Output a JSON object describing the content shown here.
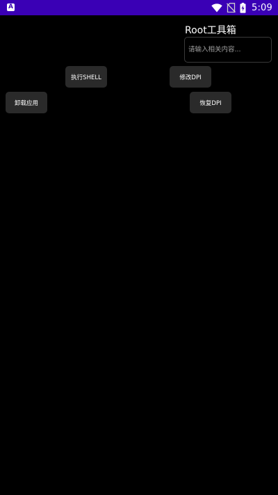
{
  "status_bar": {
    "notification_icon": "A",
    "time": "5:09",
    "icons": [
      "wifi-icon",
      "no-sim-icon",
      "battery-charging-icon"
    ],
    "background": "#3a00b5"
  },
  "app": {
    "title": "Root工具箱"
  },
  "search": {
    "placeholder": "请输入相关内容...",
    "value": ""
  },
  "actions": {
    "exec_shell": "执行SHELL",
    "edit_dpi": "修改DPI",
    "uninstall_app": "卸载应用",
    "restore_dpi": "恢复DPI"
  },
  "colors": {
    "background": "#000000",
    "button_bg": "#2a2a2a",
    "text": "#ffffff"
  }
}
